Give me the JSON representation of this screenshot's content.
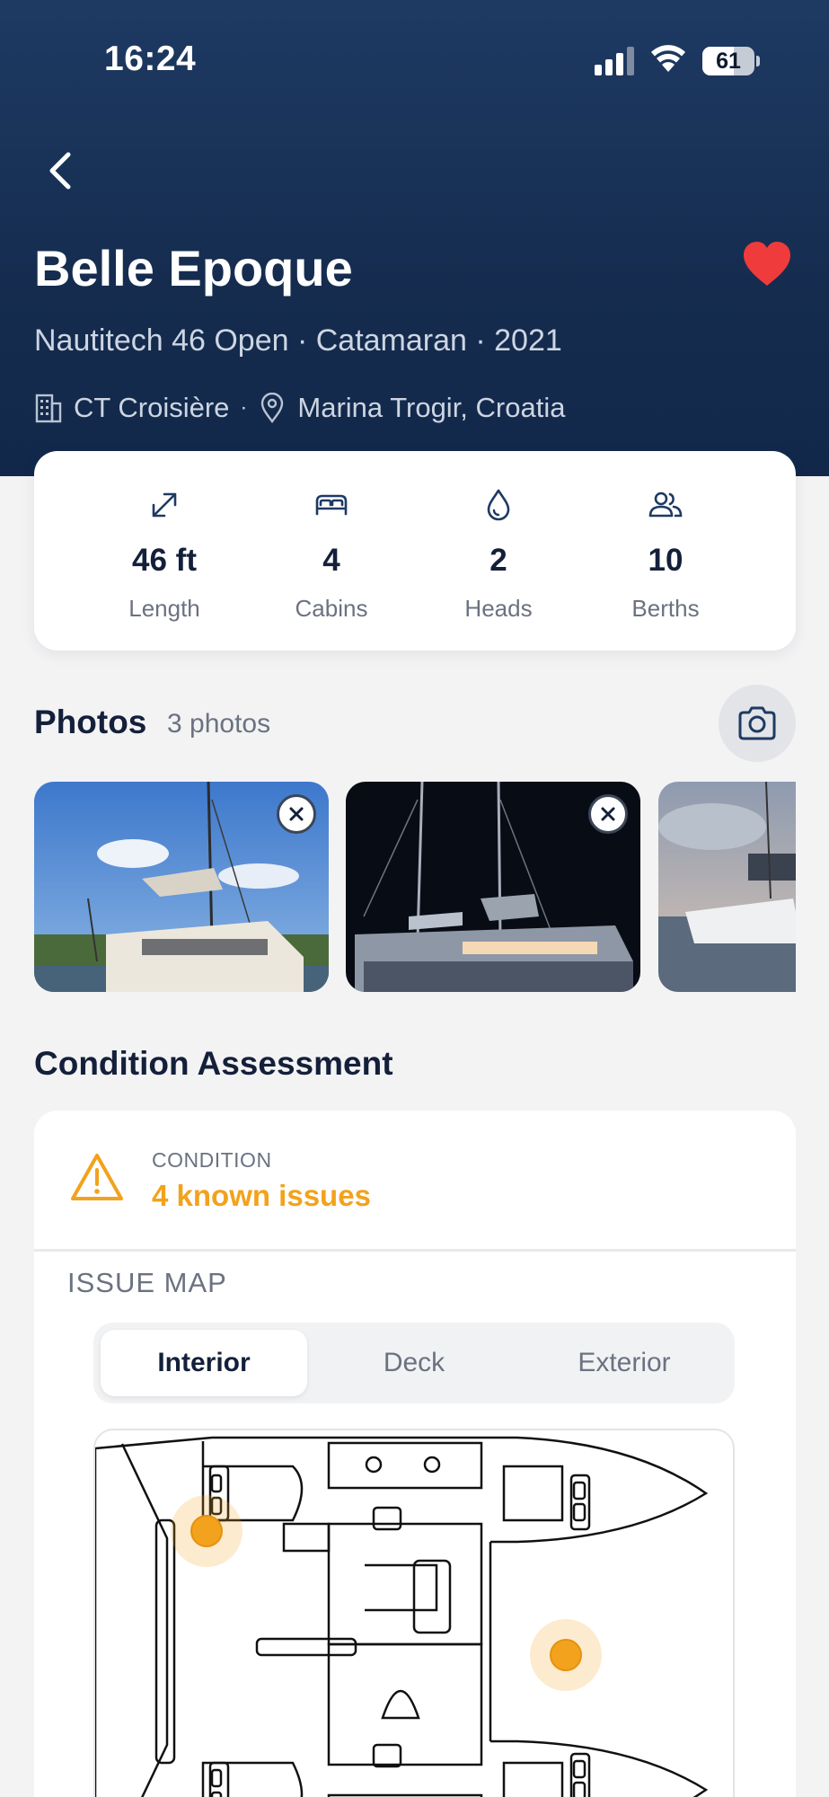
{
  "status_bar": {
    "time": "16:24",
    "battery_level": "61",
    "battery_fraction": 0.61
  },
  "header": {
    "back_icon": "chevron-left-icon",
    "title": "Belle Epoque",
    "favorite": true,
    "favorite_color": "#ef3b3b",
    "subtitle": "Nautitech 46 Open · Catamaran · 2021",
    "company": "CT Croisière",
    "location": "Marina Trogir, Croatia",
    "separator": "·"
  },
  "specs": [
    {
      "icon": "arrows-expand-icon",
      "value": "46 ft",
      "label": "Length"
    },
    {
      "icon": "bed-icon",
      "value": "4",
      "label": "Cabins"
    },
    {
      "icon": "water-drop-icon",
      "value": "2",
      "label": "Heads"
    },
    {
      "icon": "people-icon",
      "value": "10",
      "label": "Berths"
    }
  ],
  "photos": {
    "title": "Photos",
    "count_label": "3 photos",
    "items": [
      {
        "name": "catamaran-daytime-photo"
      },
      {
        "name": "catamaran-night-photo"
      },
      {
        "name": "catamaran-sunset-photo"
      }
    ]
  },
  "condition": {
    "section_title": "Condition Assessment",
    "label": "CONDITION",
    "value": "4 known issues",
    "warning_color": "#f2a21c",
    "issue_map_label": "ISSUE MAP",
    "tabs": [
      {
        "label": "Interior",
        "active": true
      },
      {
        "label": "Deck",
        "active": false
      },
      {
        "label": "Exterior",
        "active": false
      }
    ]
  }
}
